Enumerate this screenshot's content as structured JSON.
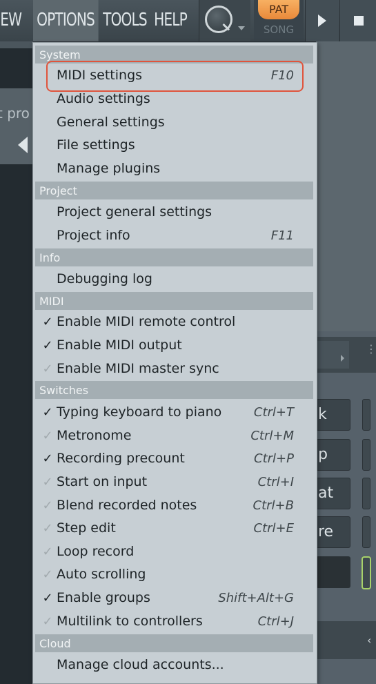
{
  "menubar": {
    "view": "IEW",
    "options": "OPTIONS",
    "tools": "TOOLS",
    "help": "HELP"
  },
  "transport": {
    "pat": "PAT",
    "song": "SONG"
  },
  "background": {
    "left_text": "t pro",
    "right_buttons": [
      "k",
      "p",
      "at",
      "re"
    ]
  },
  "options_menu": {
    "sections": [
      {
        "header": "System",
        "items": [
          {
            "label": "MIDI settings",
            "shortcut": "F10"
          },
          {
            "label": "Audio settings",
            "shortcut": ""
          },
          {
            "label": "General settings",
            "shortcut": ""
          },
          {
            "label": "File settings",
            "shortcut": ""
          },
          {
            "label": "Manage plugins",
            "shortcut": ""
          }
        ]
      },
      {
        "header": "Project",
        "items": [
          {
            "label": "Project general settings",
            "shortcut": ""
          },
          {
            "label": "Project info",
            "shortcut": "F11"
          }
        ]
      },
      {
        "header": "Info",
        "items": [
          {
            "label": "Debugging log",
            "shortcut": ""
          }
        ]
      },
      {
        "header": "MIDI",
        "items": [
          {
            "label": "Enable MIDI remote control",
            "shortcut": "",
            "checked": true
          },
          {
            "label": "Enable MIDI output",
            "shortcut": "",
            "checked": true
          },
          {
            "label": "Enable MIDI master sync",
            "shortcut": "",
            "checked": false
          }
        ]
      },
      {
        "header": "Switches",
        "items": [
          {
            "label": "Typing keyboard to piano",
            "shortcut": "Ctrl+T",
            "checked": true
          },
          {
            "label": "Metronome",
            "shortcut": "Ctrl+M",
            "checked": false
          },
          {
            "label": "Recording precount",
            "shortcut": "Ctrl+P",
            "checked": true
          },
          {
            "label": "Start on input",
            "shortcut": "Ctrl+I",
            "checked": false
          },
          {
            "label": "Blend recorded notes",
            "shortcut": "Ctrl+B",
            "checked": false
          },
          {
            "label": "Step edit",
            "shortcut": "Ctrl+E",
            "checked": false
          },
          {
            "label": "Loop record",
            "shortcut": "",
            "checked": false
          },
          {
            "label": "Auto scrolling",
            "shortcut": "",
            "checked": false
          },
          {
            "label": "Enable groups",
            "shortcut": "Shift+Alt+G",
            "checked": true
          },
          {
            "label": "Multilink to controllers",
            "shortcut": "Ctrl+J",
            "checked": false
          }
        ]
      },
      {
        "header": "Cloud",
        "items": [
          {
            "label": "Manage cloud accounts...",
            "shortcut": ""
          }
        ]
      }
    ],
    "check_glyph": "✓",
    "highlight_color": "#e0543c"
  }
}
